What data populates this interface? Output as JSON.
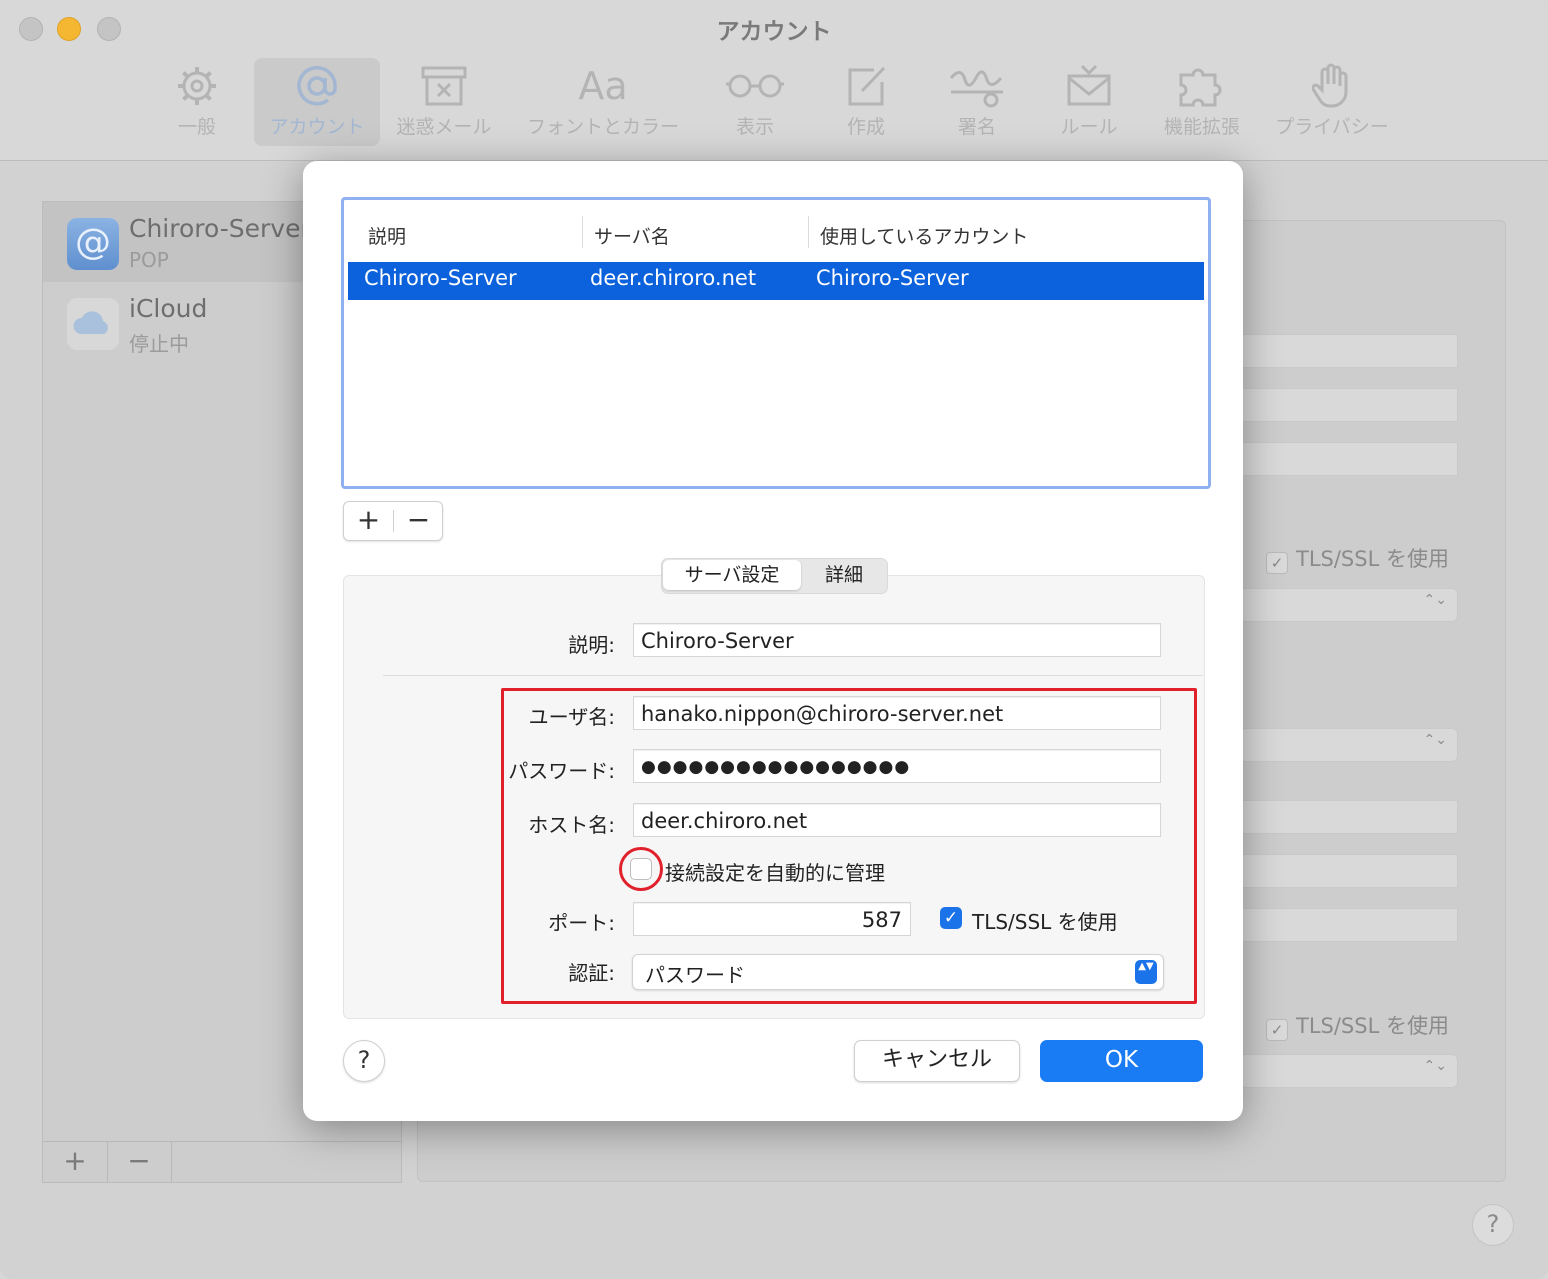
{
  "window": {
    "title": "アカウント"
  },
  "toolbar": {
    "items": [
      {
        "label": "一般",
        "icon": "gear-icon"
      },
      {
        "label": "アカウント",
        "icon": "at-icon",
        "active": true
      },
      {
        "label": "迷惑メール",
        "icon": "junk-icon"
      },
      {
        "label": "フォントとカラー",
        "icon": "fonts-icon",
        "glyph": "Aa"
      },
      {
        "label": "表示",
        "icon": "glasses-icon"
      },
      {
        "label": "作成",
        "icon": "compose-icon"
      },
      {
        "label": "署名",
        "icon": "signature-icon"
      },
      {
        "label": "ルール",
        "icon": "rules-icon"
      },
      {
        "label": "機能拡張",
        "icon": "puzzle-icon"
      },
      {
        "label": "プライバシー",
        "icon": "hand-icon"
      }
    ]
  },
  "sidebar": {
    "accounts": [
      {
        "name": "Chiroro-Server",
        "sub": "POP",
        "icon": "at-icon",
        "glyph": "@"
      },
      {
        "name": "iCloud",
        "sub": "停止中",
        "icon": "cloud-icon"
      }
    ],
    "add_label": "+",
    "remove_label": "−"
  },
  "background_panel": {
    "tls_label_1": "TLS/SSL を使用",
    "tls_label_2": "TLS/SSL を使用",
    "check_mark": "✓",
    "stepper_glyph": "⌃⌄"
  },
  "dialog": {
    "table": {
      "headers": [
        "説明",
        "サーバ名",
        "使用しているアカウント"
      ],
      "rows": [
        [
          "Chiroro-Server",
          "deer.chiroro.net",
          "Chiroro-Server"
        ]
      ]
    },
    "add_label": "+",
    "remove_label": "−",
    "tabs": [
      "サーバ設定",
      "詳細"
    ],
    "form": {
      "description_label": "説明:",
      "description_value": "Chiroro-Server",
      "username_label": "ユーザ名:",
      "username_value": "hanako.nippon@chiroro-server.net",
      "password_label": "パスワード:",
      "password_value": "●●●●●●●●●●●●●●●●●",
      "host_label": "ホスト名:",
      "host_value": "deer.chiroro.net",
      "auto_manage_label": "接続設定を自動的に管理",
      "auto_manage_checked": false,
      "port_label": "ポート:",
      "port_value": "587",
      "tls_label": "TLS/SSL を使用",
      "tls_checked": true,
      "check_mark": "✓",
      "auth_label": "認証:",
      "auth_value": "パスワード",
      "auth_arrows": "▲▼"
    },
    "help_label": "?",
    "cancel_label": "キャンセル",
    "ok_label": "OK"
  },
  "window_help_label": "?",
  "colors": {
    "accent": "#1a7cf5",
    "selection": "#0b62dc",
    "highlight_red": "#e0202a",
    "table_focus": "#8fb1f2"
  }
}
